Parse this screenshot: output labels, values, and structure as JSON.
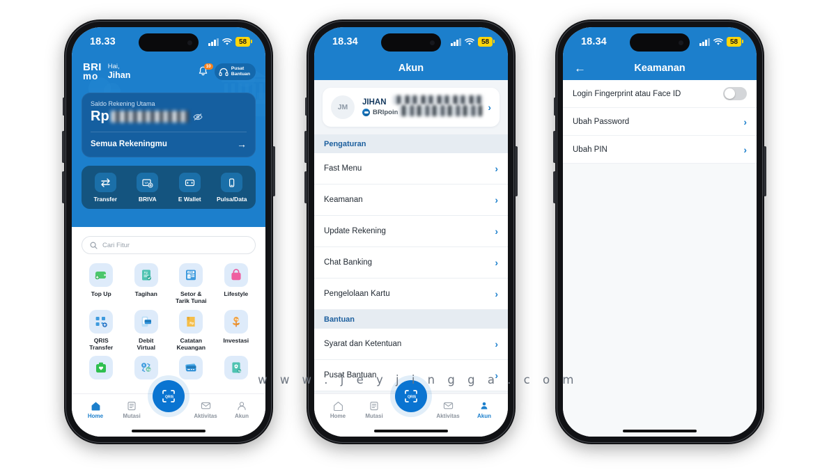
{
  "watermark": "w w w . j e y j i n g g a . c o m",
  "phone1": {
    "name": "brimo-home-screen",
    "statusbar": {
      "time": "18.33",
      "battery": "58",
      "signal_icon": "cellular-bars-icon",
      "wifi_icon": "wifi-icon"
    },
    "header": {
      "brand_line1": "BRI",
      "brand_line2": "mo",
      "greeting_line1": "Hai,",
      "greeting_line2": "Jihan",
      "notification_badge": "10",
      "help_line1": "Pusat",
      "help_line2": "Bantuan"
    },
    "balance": {
      "label": "Saldo Rekening Utama",
      "currency": "Rp",
      "amount_hidden": true,
      "all_accounts_label": "Semua Rekeningmu"
    },
    "quick_actions": [
      {
        "label": "Transfer",
        "icon": "transfer-arrows-icon"
      },
      {
        "label": "BRIVA",
        "icon": "briva-icon"
      },
      {
        "label": "E Wallet",
        "icon": "wallet-icon"
      },
      {
        "label": "Pulsa/Data",
        "icon": "phone-icon"
      }
    ],
    "search": {
      "placeholder": "Cari Fitur",
      "icon": "search-icon"
    },
    "grid": [
      {
        "label": "Top Up",
        "icon": "topup-icon",
        "color": "#4CC76B"
      },
      {
        "label": "Tagihan",
        "icon": "bill-icon",
        "color": "#3FB5A3"
      },
      {
        "label": "Setor &\nTarik Tunai",
        "icon": "atm-icon",
        "color": "#2E8FD6"
      },
      {
        "label": "Lifestyle",
        "icon": "bag-icon",
        "color": "#EF5FA0"
      },
      {
        "label": "QRIS\nTransfer",
        "icon": "qris-icon",
        "color": "#2E8FD6"
      },
      {
        "label": "Debit\nVirtual",
        "icon": "debit-card-icon",
        "color": "#4A9BE0"
      },
      {
        "label": "Catatan\nKeuangan",
        "icon": "notes-icon",
        "color": "#F2B33D"
      },
      {
        "label": "Investasi",
        "icon": "invest-icon",
        "color": "#F08C2E"
      },
      {
        "label": "",
        "icon": "health-bag-icon",
        "color": "#2FBF4F"
      },
      {
        "label": "",
        "icon": "currency-exchange-icon",
        "color": "#4A9BE0"
      },
      {
        "label": "",
        "icon": "card-icon",
        "color": "#2E8FD6"
      },
      {
        "label": "",
        "icon": "passbook-icon",
        "color": "#3FB5A3"
      }
    ],
    "tabs": [
      {
        "label": "Home",
        "icon": "home-icon",
        "active": true
      },
      {
        "label": "Mutasi",
        "icon": "list-icon",
        "active": false
      },
      {
        "label": "Aktivitas",
        "icon": "envelope-icon",
        "active": false
      },
      {
        "label": "Akun",
        "icon": "person-icon",
        "active": false
      }
    ],
    "fab": {
      "label": "QRIS",
      "icon": "qr-scan-icon"
    }
  },
  "phone2": {
    "name": "brimo-account-screen",
    "statusbar": {
      "time": "18.34",
      "battery": "58"
    },
    "navbar": {
      "title": "Akun"
    },
    "profile": {
      "avatar_initials": "JM",
      "name": "JIHAN",
      "name_redacted": true,
      "points_label": "BRIpoin",
      "chevron": "›"
    },
    "sections": [
      {
        "header": "Pengaturan",
        "items": [
          {
            "label": "Fast Menu"
          },
          {
            "label": "Keamanan"
          },
          {
            "label": "Update Rekening"
          },
          {
            "label": "Chat Banking"
          },
          {
            "label": "Pengelolaan Kartu"
          }
        ]
      },
      {
        "header": "Bantuan",
        "items": [
          {
            "label": "Syarat dan Ketentuan"
          },
          {
            "label": "Pusat Bantuan"
          }
        ]
      }
    ],
    "tabs": [
      {
        "label": "Home",
        "icon": "home-icon",
        "active": false
      },
      {
        "label": "Mutasi",
        "icon": "list-icon",
        "active": false
      },
      {
        "label": "Aktivitas",
        "icon": "envelope-icon",
        "active": false
      },
      {
        "label": "Akun",
        "icon": "person-icon",
        "active": true
      }
    ],
    "fab": {
      "label": "QRIS",
      "icon": "qr-scan-icon"
    }
  },
  "phone3": {
    "name": "brimo-security-screen",
    "statusbar": {
      "time": "18.34",
      "battery": "58"
    },
    "navbar": {
      "title": "Keamanan",
      "back_icon": "arrow-left-icon"
    },
    "rows": [
      {
        "label": "Login Fingerprint atau Face ID",
        "control": "toggle",
        "toggle_on": false
      },
      {
        "label": "Ubah Password",
        "control": "chevron"
      },
      {
        "label": "Ubah PIN",
        "control": "chevron"
      }
    ]
  },
  "colors": {
    "brand_blue": "#1C7FCC",
    "deep_blue": "#155FA0",
    "fab_blue": "#0A74D1",
    "battery_yellow": "#FFD60A",
    "badge_orange": "#F5821F",
    "page_gray": "#F2F5F8"
  }
}
